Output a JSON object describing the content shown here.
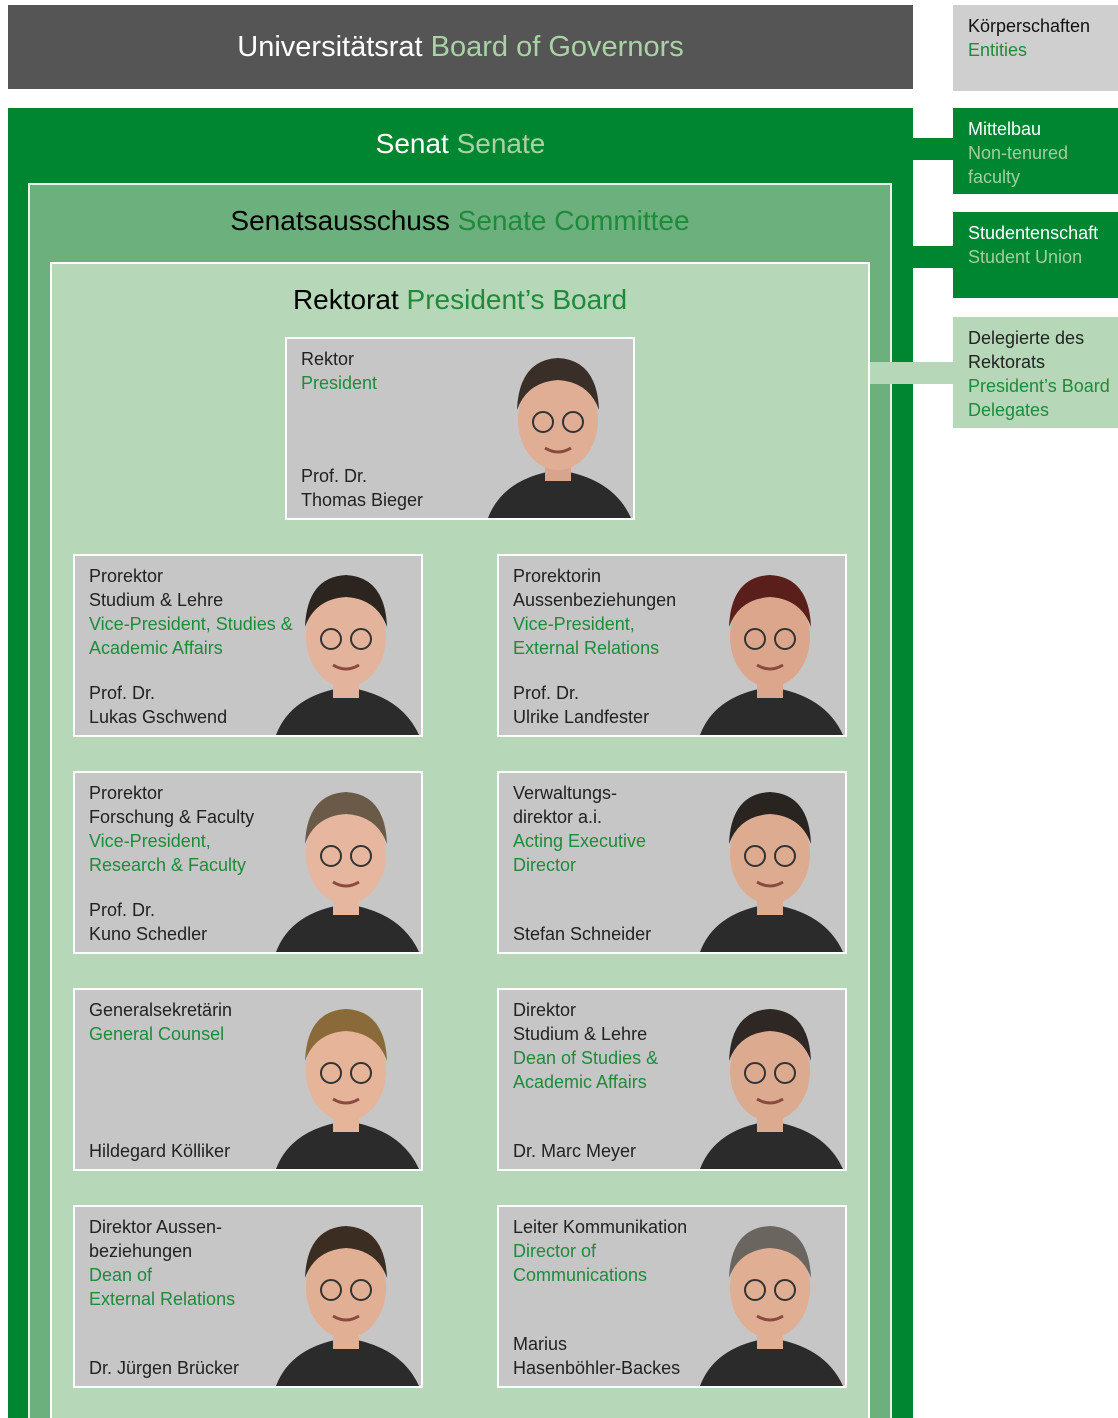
{
  "board": {
    "de": "Universitätsrat",
    "en": "Board of Governors"
  },
  "senate": {
    "de": "Senat",
    "en": "Senate"
  },
  "committee": {
    "de": "Senatsausschuss",
    "en": "Senate Committee"
  },
  "rektorat": {
    "de": "Rektorat",
    "en": "President’s Board"
  },
  "president": {
    "role_de": "Rektor",
    "role_en": "President",
    "name": "Prof. Dr.\nThomas Bieger"
  },
  "members": [
    {
      "role_de": "Prorektor\nStudium & Lehre",
      "role_en": "Vice-President, Studies &\nAcademic Affairs",
      "name": "Prof. Dr.\nLukas Gschwend"
    },
    {
      "role_de": "Prorektorin\nAussenbeziehungen",
      "role_en": "Vice-President,\nExternal Relations",
      "name": "Prof. Dr.\nUlrike Landfester"
    },
    {
      "role_de": "Prorektor\nForschung & Faculty",
      "role_en": "Vice-President,\nResearch & Faculty",
      "name": "Prof. Dr.\nKuno Schedler"
    },
    {
      "role_de": "Verwaltungs-\ndirektor a.i.",
      "role_en": "Acting Executive\nDirector",
      "name": "Stefan Schneider"
    },
    {
      "role_de": "Generalsekretärin",
      "role_en": "General Counsel",
      "name": "Hildegard Kölliker"
    },
    {
      "role_de": "Direktor\nStudium & Lehre",
      "role_en": "Dean of Studies &\nAcademic Affairs",
      "name": "Dr. Marc Meyer"
    },
    {
      "role_de": "Direktor Aussen-\nbeziehungen",
      "role_en": "Dean of\nExternal Relations",
      "name": "Dr. Jürgen Brücker"
    },
    {
      "role_de": "Leiter Kommunikation",
      "role_en": "Director of\nCommunications",
      "name": "Marius\nHasenböhler-Backes"
    }
  ],
  "side": {
    "entities": {
      "de": "Körperschaften",
      "en": "Entities"
    },
    "mittelbau": {
      "de": "Mittelbau",
      "en": "Non-tenured\nfaculty"
    },
    "student": {
      "de": "Studentenschaft",
      "en": "Student Union"
    },
    "delegates": {
      "de": "Delegierte des\nRektorats",
      "en": "President’s Board\nDelegates"
    }
  },
  "colors": {
    "green": "#008531",
    "grey_bar": "#555555",
    "mid_green": "#6cb07d",
    "light_green": "#b6d7b8",
    "card_grey": "#c6c6c6"
  },
  "icon_names": [
    "portrait-photo"
  ]
}
